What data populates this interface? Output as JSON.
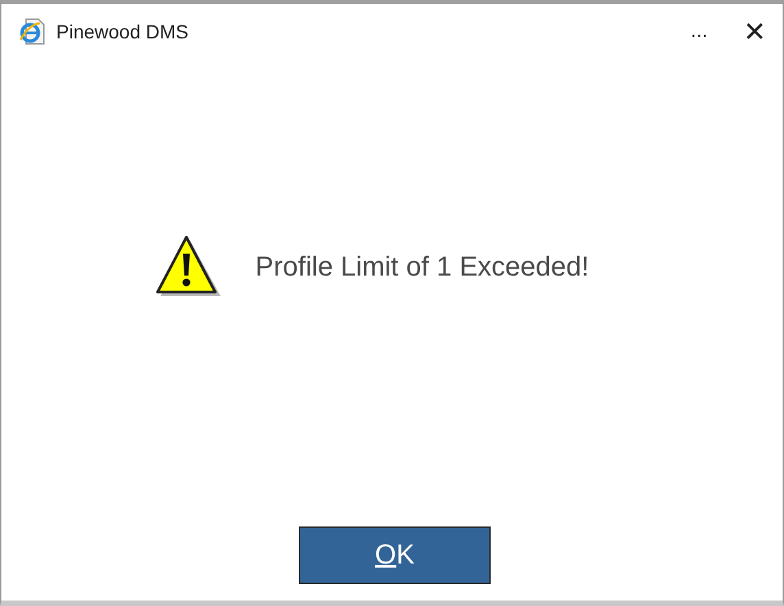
{
  "window": {
    "title": "Pinewood DMS",
    "more_label": "...",
    "close_label": "✕"
  },
  "message": {
    "text": "Profile Limit of 1 Exceeded!"
  },
  "button": {
    "label": "OK",
    "underline_first": true
  }
}
